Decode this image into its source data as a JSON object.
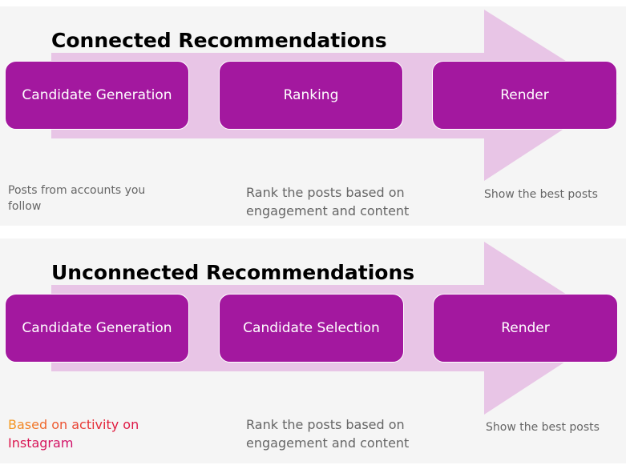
{
  "colors": {
    "stage_fill": "#a3189f",
    "arrow_fill": "#e8c5e6",
    "panel_bg": "#f5f5f5",
    "caption_text": "#666666",
    "instagram_gradient": [
      "#f59d1f",
      "#ee5a2a",
      "#e0173d",
      "#d0106a"
    ]
  },
  "connected": {
    "title": "Connected Recommendations",
    "stages": [
      "Candidate Generation",
      "Ranking",
      "Render"
    ],
    "captions": [
      "Posts from accounts you follow",
      "Rank the posts based on engagement and content",
      "Show the best posts"
    ]
  },
  "unconnected": {
    "title": "Unconnected Recommendations",
    "stages": [
      "Candidate Generation",
      "Candidate Selection",
      "Render"
    ],
    "captions": [
      "Based on activity on Instagram",
      "Rank the posts based on engagement and content",
      "Show the best posts"
    ]
  }
}
